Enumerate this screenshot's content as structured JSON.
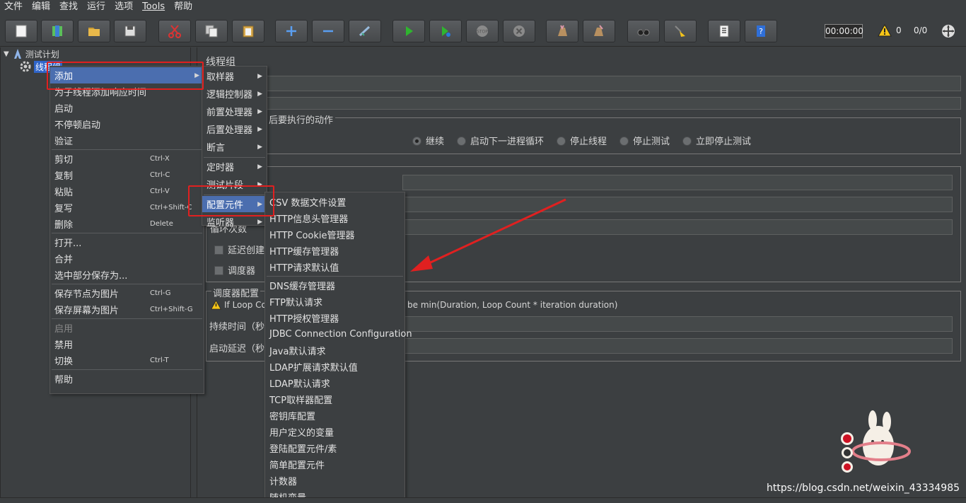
{
  "menubar": [
    "文件",
    "编辑",
    "查找",
    "运行",
    "选项",
    "Tools",
    "帮助"
  ],
  "toolbar": {
    "buttons": [
      "new-icon",
      "templates-icon",
      "open-icon",
      "save-icon",
      "cut-icon",
      "copy-icon",
      "paste-icon",
      "expand-icon",
      "collapse-icon",
      "toggle-icon",
      "start-icon",
      "start-no-pause-icon",
      "stop-icon",
      "shutdown-icon",
      "clear-icon",
      "clear-all-icon",
      "search-icon",
      "reset-search-icon",
      "function-helper-icon",
      "help-icon"
    ],
    "timer": "00:00:00",
    "warn_count": "0",
    "threads": "0/0"
  },
  "tree": {
    "root": "测试计划",
    "child": "线程组"
  },
  "rightpanel": {
    "title": "线程组",
    "action_group_label": "后要执行的动作",
    "radios": [
      "继续",
      "启动下一进程循环",
      "停止线程",
      "停止测试",
      "立即停止测试"
    ],
    "loop_label": "循环次数",
    "delay_label": "延迟创建",
    "scheduler_label": "调度器",
    "scheduler_config": "调度器配置",
    "warn_text_left": "If Loop Cou",
    "warn_text_right": "be min(Duration, Loop Count * iteration duration)",
    "duration_label": "持续时间（秒",
    "startup_delay_label": "启动延迟（秒"
  },
  "context_menu": {
    "items": [
      {
        "label": "添加",
        "shortcut": ""
      },
      {
        "label": "为子线程添加响应时间",
        "shortcut": ""
      },
      {
        "label": "启动",
        "shortcut": ""
      },
      {
        "label": "不停顿启动",
        "shortcut": ""
      },
      {
        "label": "验证",
        "shortcut": ""
      },
      {
        "label": "剪切",
        "shortcut": "Ctrl-X"
      },
      {
        "label": "复制",
        "shortcut": "Ctrl-C"
      },
      {
        "label": "粘贴",
        "shortcut": "Ctrl-V"
      },
      {
        "label": "复写",
        "shortcut": "Ctrl+Shift-C"
      },
      {
        "label": "删除",
        "shortcut": "Delete"
      },
      {
        "label": "打开...",
        "shortcut": ""
      },
      {
        "label": "合并",
        "shortcut": ""
      },
      {
        "label": "选中部分保存为...",
        "shortcut": ""
      },
      {
        "label": "保存节点为图片",
        "shortcut": "Ctrl-G"
      },
      {
        "label": "保存屏幕为图片",
        "shortcut": "Ctrl+Shift-G"
      },
      {
        "label": "启用",
        "shortcut": ""
      },
      {
        "label": "禁用",
        "shortcut": ""
      },
      {
        "label": "切换",
        "shortcut": "Ctrl-T"
      },
      {
        "label": "帮助",
        "shortcut": ""
      }
    ]
  },
  "add_menu": {
    "items": [
      "取样器",
      "逻辑控制器",
      "前置处理器",
      "后置处理器",
      "断言",
      "定时器",
      "测试片段",
      "配置元件",
      "监听器"
    ]
  },
  "config_menu": {
    "items": [
      "CSV 数据文件设置",
      "HTTP信息头管理器",
      "HTTP Cookie管理器",
      "HTTP缓存管理器",
      "HTTP请求默认值",
      "DNS缓存管理器",
      "FTP默认请求",
      "HTTP授权管理器",
      "JDBC Connection Configuration",
      "Java默认请求",
      "LDAP扩展请求默认值",
      "LDAP默认请求",
      "TCP取样器配置",
      "密钥库配置",
      "用户定义的变量",
      "登陆配置元件/素",
      "简单配置元件",
      "计数器",
      "随机变量"
    ]
  },
  "watermark": "https://blog.csdn.net/weixin_43334985",
  "colors": {
    "highlight": "#4b6eaf",
    "annotation": "#e02020",
    "background": "#3c3f41"
  }
}
